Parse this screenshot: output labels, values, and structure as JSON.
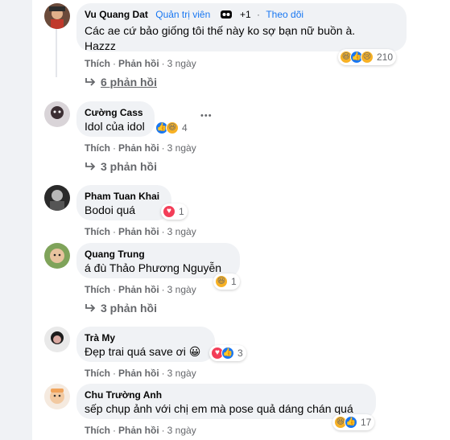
{
  "comments": [
    {
      "name": "Vu Quang Dat",
      "admin_badge": "Quản trị viên",
      "plus": "+1",
      "sep": "·",
      "follow": "Theo dõi",
      "text_lines": [
        "Các ae cứ bảo giống tôi thế này ko sợ bạn nữ buồn à.",
        "Hazzz"
      ],
      "reaction_icons": [
        "haha-icon",
        "like-icon",
        "sad-icon"
      ],
      "reaction_count": "210",
      "like": "Thích",
      "reply": "Phản hồi",
      "time": "3 ngày",
      "replies": "6 phản hồi"
    },
    {
      "name": "Cường Cass",
      "text_lines": [
        "Idol của idol"
      ],
      "reaction_icons": [
        "like-icon",
        "haha-icon"
      ],
      "reaction_count": "4",
      "more": "•••",
      "like": "Thích",
      "reply": "Phản hồi",
      "time": "3 ngày",
      "replies": "3 phản hồi"
    },
    {
      "name": "Pham Tuan Khai",
      "text_lines": [
        "Bodoi quá"
      ],
      "reaction_icons": [
        "love-icon"
      ],
      "reaction_count": "1",
      "like": "Thích",
      "reply": "Phản hồi",
      "time": "3 ngày"
    },
    {
      "name": "Quang Trung",
      "text_prefix": "á đù ",
      "mention": "Thảo Phương Nguyễn",
      "reaction_icons": [
        "haha-icon"
      ],
      "reaction_count": "1",
      "like": "Thích",
      "reply": "Phản hồi",
      "time": "3 ngày",
      "replies": "3 phản hồi"
    },
    {
      "name": "Trà My",
      "text_lines": [
        "Đẹp trai quá save ơi 😀"
      ],
      "reaction_icons": [
        "love-icon",
        "like-icon"
      ],
      "reaction_count": "3",
      "like": "Thích",
      "reply": "Phản hồi",
      "time": "3 ngày"
    },
    {
      "name": "Chu Trường Anh",
      "text_lines": [
        "sếp chụp ảnh với chị em mà pose quả dáng chán quá"
      ],
      "reaction_icons": [
        "haha-icon",
        "like-icon"
      ],
      "reaction_count": "17",
      "like": "Thích",
      "reply": "Phản hồi",
      "time": "3 ngày"
    }
  ],
  "colors": {
    "link_blue": "#1877f2",
    "secondary_text": "#65676b",
    "bubble_bg": "#f0f2f5"
  }
}
